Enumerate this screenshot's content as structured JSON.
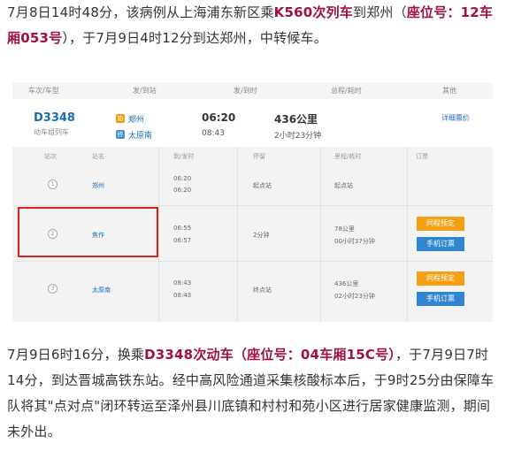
{
  "para1": {
    "t1": "7月8日14时48分，该病例从上海浦东新区乘",
    "h1": "K560次列车",
    "t2": "到郑州（",
    "h2": "座位号：12车厢053号",
    "t3": "），于7月9日4时12分到达郑州，中转候车。"
  },
  "table": {
    "headers": {
      "train": "车次/车型",
      "station": "发/到站",
      "time": "发/到时",
      "duration": "总程/耗时",
      "other": "其他"
    },
    "summary": {
      "train_no": "D3348",
      "train_type": "动车组列车",
      "start_tag": "始",
      "end_tag": "终",
      "from": "郑州",
      "to": "太原南",
      "dep_time": "06:20",
      "arr_time": "08:43",
      "distance": "436公里",
      "duration": "2小时23分钟",
      "price_link": "详细票价"
    },
    "detail_headers": {
      "seq": "站次",
      "station": "站名",
      "times": "到/发时",
      "stop": "停留",
      "mileage": "里程/耗时",
      "booking": "订票"
    },
    "rows": [
      {
        "seq": "1",
        "station": "郑州",
        "arr": "06:20",
        "dep": "06:20",
        "stop": "起点站",
        "km": "起点站",
        "elapsed": ""
      },
      {
        "seq": "2",
        "station": "焦作",
        "arr": "06:55",
        "dep": "06:57",
        "stop": "2分钟",
        "km": "78公里",
        "elapsed": "00小时37分钟"
      },
      {
        "seq": "3",
        "station": "太原南",
        "arr": "08:43",
        "dep": "08:43",
        "stop": "终点站",
        "km": "436公里",
        "elapsed": "02小时23分钟"
      }
    ],
    "btn_reserve": "同程预定",
    "btn_mobile": "手机订票",
    "colors": {
      "link": "#1b6bb5",
      "orange": "#f5a012",
      "blue": "#2f86cf",
      "highlight_box": "#e02020"
    }
  },
  "para2": {
    "t1": "7月9日6时16分，换乘",
    "h1": "D3348次动车（座位号：04车厢15C号）",
    "t2": "，于7月9日7时14分，到达晋城高铁东站。经中高风险通道采集核酸标本后，于9时25分由保障车队将其\"点对点\"闭环转运至泽州县川底镇和村村和苑小区进行居家健康监测，期间未外出。"
  },
  "colors": {
    "highlight": "#a0113c"
  }
}
